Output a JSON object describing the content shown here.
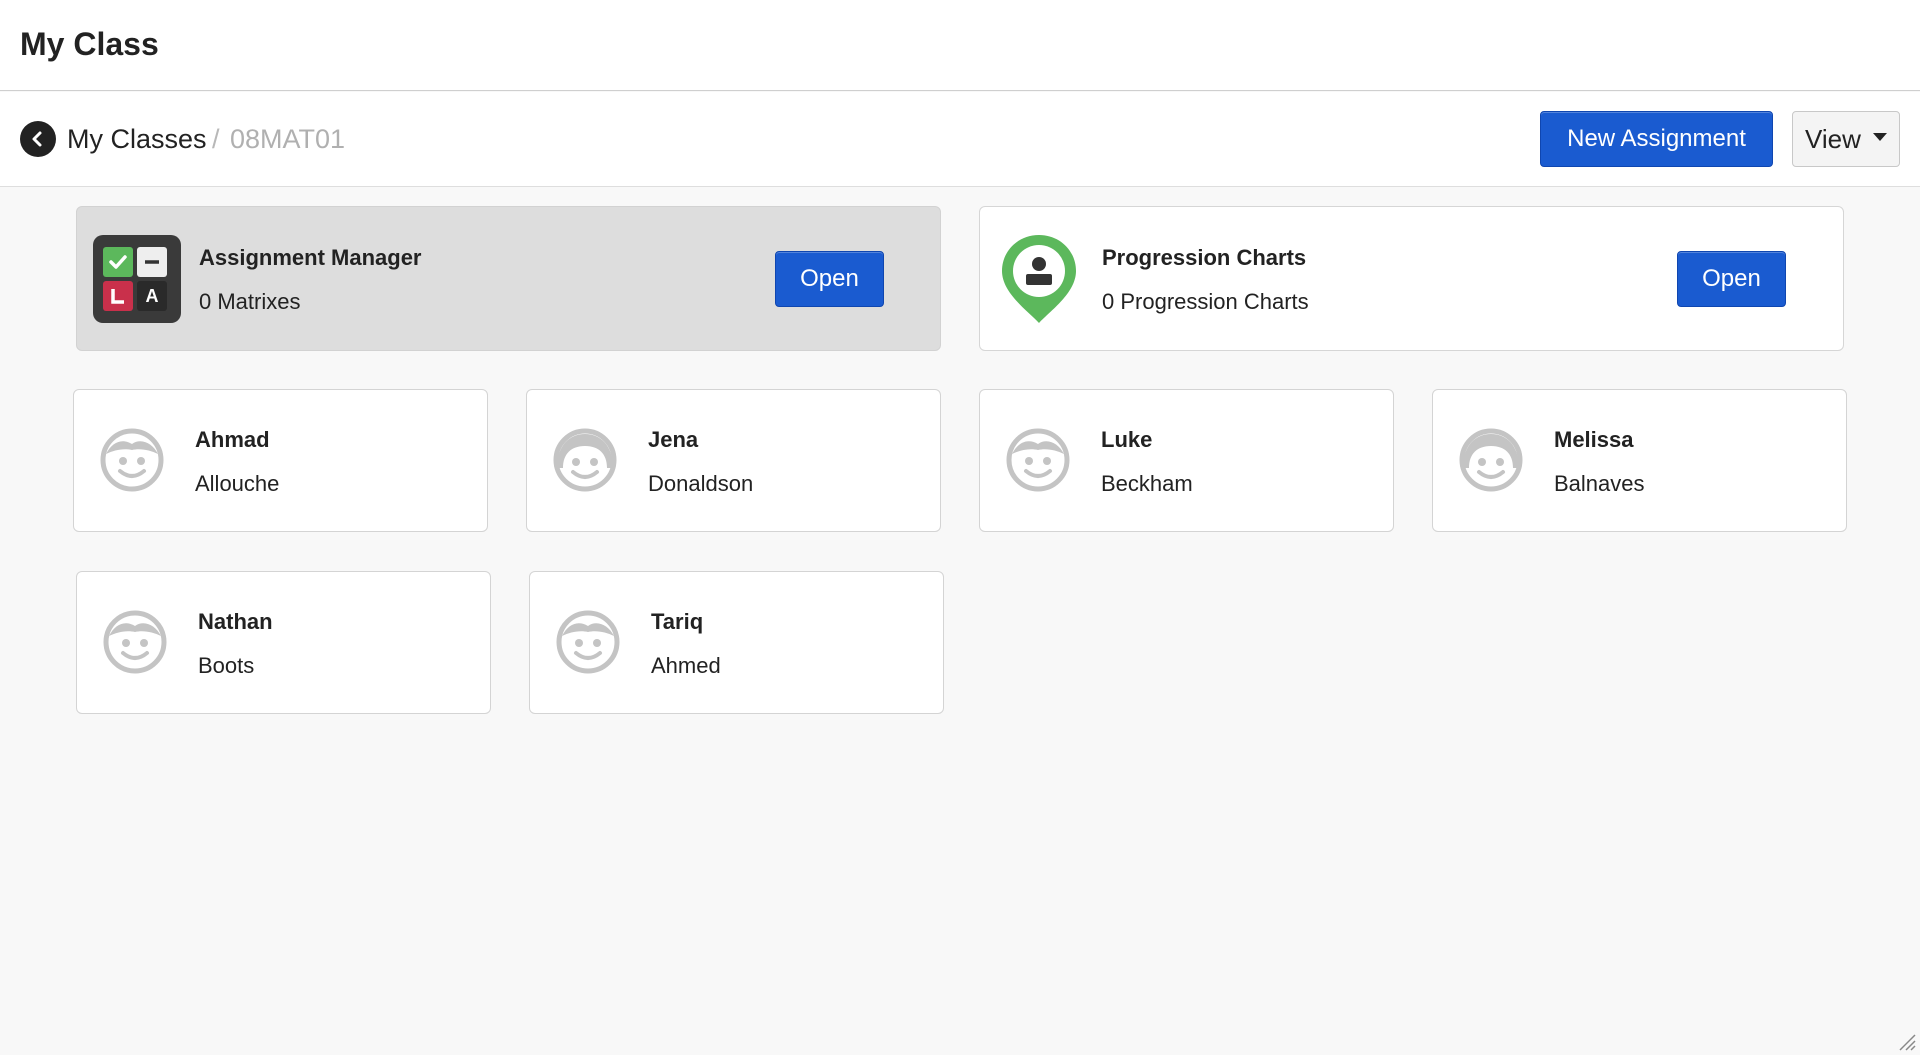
{
  "header": {
    "title": "My Class"
  },
  "breadcrumb": {
    "parent": "My Classes",
    "separator": "/",
    "current": "08MAT01"
  },
  "toolbar": {
    "new_assignment": "New Assignment",
    "view": "View"
  },
  "tools": {
    "assignment_manager": {
      "title": "Assignment Manager",
      "subtitle": "0 Matrixes",
      "open": "Open",
      "icon_letter": "A"
    },
    "progression_charts": {
      "title": "Progression Charts",
      "subtitle": "0 Progression Charts",
      "open": "Open"
    }
  },
  "students": [
    {
      "first": "Ahmad",
      "last": "Allouche"
    },
    {
      "first": "Jena",
      "last": "Donaldson"
    },
    {
      "first": "Luke",
      "last": "Beckham"
    },
    {
      "first": "Melissa",
      "last": "Balnaves"
    },
    {
      "first": "Nathan",
      "last": "Boots"
    },
    {
      "first": "Tariq",
      "last": "Ahmed"
    }
  ],
  "colors": {
    "primary": "#1a5bd0",
    "green": "#5cb85c",
    "red": "#c9304b",
    "icon_gray": "#c4c4c4"
  }
}
